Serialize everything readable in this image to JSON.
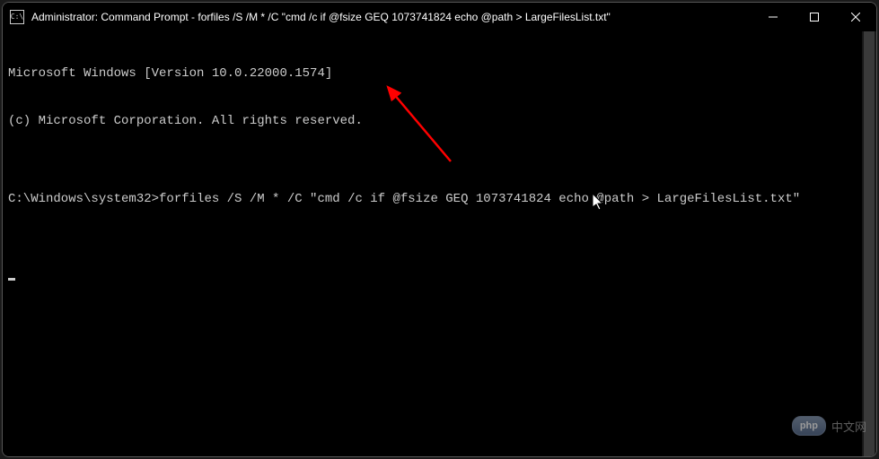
{
  "titlebar": {
    "icon_text": "C:\\",
    "title": "Administrator: Command Prompt - forfiles  /S /M * /C \"cmd /c if @fsize GEQ 1073741824 echo @path > LargeFilesList.txt\""
  },
  "window_controls": {
    "minimize": "minimize",
    "maximize": "maximize",
    "close": "close"
  },
  "terminal": {
    "line1": "Microsoft Windows [Version 10.0.22000.1574]",
    "line2": "(c) Microsoft Corporation. All rights reserved.",
    "blank": "",
    "prompt": "C:\\Windows\\system32>",
    "command": "forfiles /S /M * /C \"cmd /c if @fsize GEQ 1073741824 echo @path > LargeFilesList.txt\""
  },
  "watermark": {
    "badge": "php",
    "text": "中文网"
  }
}
